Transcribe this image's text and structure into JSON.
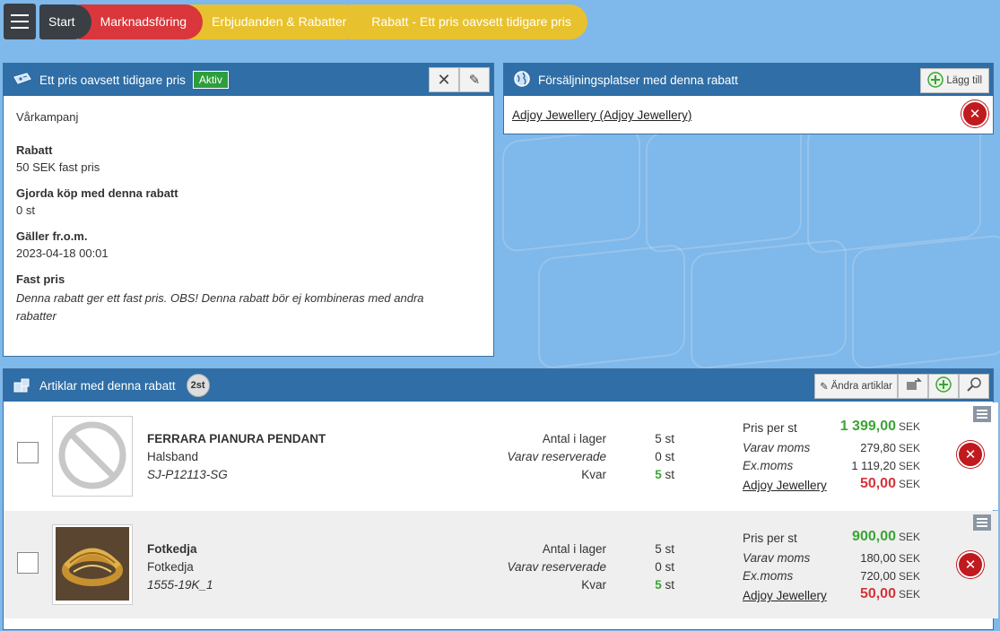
{
  "breadcrumb": {
    "items": [
      "Start",
      "Marknadsföring",
      "Erbjudanden & Rabatter",
      "Rabatt - Ett pris oavsett tidigare pris"
    ]
  },
  "discount_panel": {
    "title": "Ett pris oavsett tidigare pris",
    "status": "Aktiv",
    "name": "Vårkampanj",
    "fields": [
      {
        "label": "Rabatt",
        "value": "50 SEK fast pris"
      },
      {
        "label": "Gjorda köp med denna rabatt",
        "value": "0 st"
      },
      {
        "label": "Gäller fr.o.m.",
        "value": "2023-04-18 00:01"
      },
      {
        "label": "Fast pris",
        "value": "Denna rabatt ger ett fast pris. OBS! Denna rabatt bör ej kombineras med andra rabatter"
      }
    ]
  },
  "sales_panel": {
    "title": "Försäljningsplatser med denna rabatt",
    "add_label": "Lägg till",
    "locations": [
      "Adjoy Jewellery (Adjoy Jewellery)"
    ]
  },
  "articles_panel": {
    "title": "Artiklar med denna rabatt",
    "count": "2st",
    "edit_label": "Ändra artiklar",
    "labels": {
      "stock": "Antal i lager",
      "reserved": "Varav reserverade",
      "remaining": "Kvar",
      "price": "Pris per st",
      "vat": "Varav moms",
      "exvat": "Ex.moms",
      "currency": "SEK"
    },
    "items": [
      {
        "name": "FERRARA PIANURA PENDANT",
        "category": "Halsband",
        "sku": "SJ-P12113-SG",
        "stock": "5 st",
        "reserved": "0 st",
        "remaining": "5",
        "remaining_unit": "st",
        "price": "1 399,00",
        "vat": "279,80",
        "exvat": "1 119,20",
        "shop": "Adjoy Jewellery",
        "discount_price": "50,00",
        "image": "no-image"
      },
      {
        "name": "Fotkedja",
        "category": "Fotkedja",
        "sku": "1555-19K_1",
        "stock": "5 st",
        "reserved": "0 st",
        "remaining": "5",
        "remaining_unit": "st",
        "price": "900,00",
        "vat": "180,00",
        "exvat": "720,00",
        "shop": "Adjoy Jewellery",
        "discount_price": "50,00",
        "image": "gold-ring"
      }
    ]
  },
  "colors": {
    "header_blue": "#2f6ea6",
    "active_green": "#2e9e3c",
    "price_green": "#3ba436",
    "discount_red": "#d4343b",
    "delete_red": "#c0191e"
  }
}
